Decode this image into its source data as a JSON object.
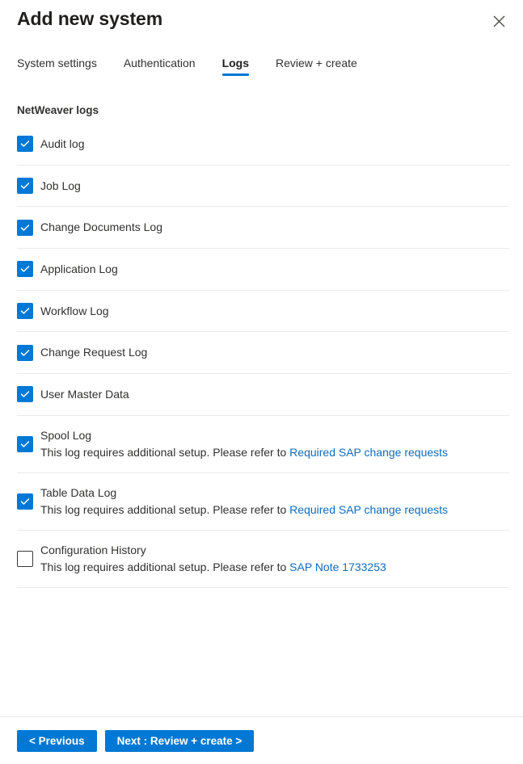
{
  "header": {
    "title": "Add new system",
    "close_icon": "close-icon"
  },
  "tabs": [
    {
      "label": "System settings",
      "active": false
    },
    {
      "label": "Authentication",
      "active": false
    },
    {
      "label": "Logs",
      "active": true
    },
    {
      "label": "Review + create",
      "active": false
    }
  ],
  "section": {
    "title": "NetWeaver logs"
  },
  "logs": [
    {
      "label": "Audit log",
      "checked": true,
      "description": null,
      "link": null
    },
    {
      "label": "Job Log",
      "checked": true,
      "description": null,
      "link": null
    },
    {
      "label": "Change Documents Log",
      "checked": true,
      "description": null,
      "link": null
    },
    {
      "label": "Application Log",
      "checked": true,
      "description": null,
      "link": null
    },
    {
      "label": "Workflow Log",
      "checked": true,
      "description": null,
      "link": null
    },
    {
      "label": "Change Request Log",
      "checked": true,
      "description": null,
      "link": null
    },
    {
      "label": "User Master Data",
      "checked": true,
      "description": null,
      "link": null
    },
    {
      "label": "Spool Log",
      "checked": true,
      "description": "This log requires additional setup. Please refer to ",
      "link": "Required SAP change requests"
    },
    {
      "label": "Table Data Log",
      "checked": true,
      "description": "This log requires additional setup. Please refer to ",
      "link": "Required SAP change requests"
    },
    {
      "label": "Configuration History",
      "checked": false,
      "description": "This log requires additional setup. Please refer to ",
      "link": "SAP Note 1733253"
    }
  ],
  "footer": {
    "previous_label": "< Previous",
    "next_label": "Next : Review + create >"
  },
  "colors": {
    "accent": "#0078d4",
    "link": "#0f6cbd",
    "text": "#323130",
    "divider": "#edebe9",
    "checkbox_border": "#3b3a39"
  }
}
